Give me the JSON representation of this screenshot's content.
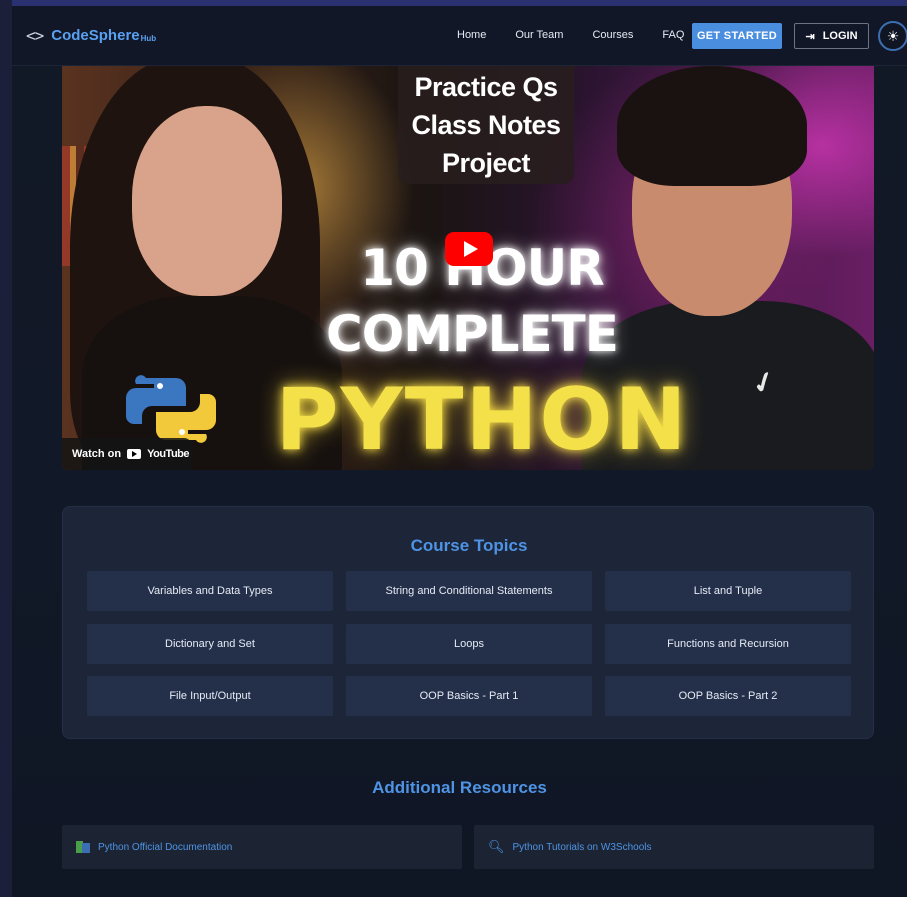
{
  "nav": {
    "brand_icon": "<>",
    "brand_name": "CodeSphere",
    "brand_suffix": "Hub",
    "links": [
      "Home",
      "Our Team",
      "Courses",
      "FAQ"
    ],
    "get_started": "GET STARTED",
    "login": "LOGIN",
    "theme_icon": "sun-icon"
  },
  "video": {
    "notes": [
      "Practice Qs",
      "Class Notes",
      "Project"
    ],
    "title_line1": "10 HOUR",
    "title_line2": "COMPLETE",
    "title_line3": "PYTHON",
    "watch_on": "Watch on",
    "youtube": "YouTube",
    "colors": {
      "play": "#ff0000",
      "python_glow": "#f4e14a"
    }
  },
  "topics": {
    "title": "Course Topics",
    "items": [
      "Variables and Data Types",
      "String and Conditional Statements",
      "List and Tuple",
      "Dictionary and Set",
      "Loops",
      "Functions and Recursion",
      "File Input/Output",
      "OOP Basics - Part 1",
      "OOP Basics - Part 2"
    ]
  },
  "resources": {
    "title": "Additional Resources",
    "items": [
      {
        "label": "Python Official Documentation",
        "icon": "docs-icon"
      },
      {
        "label": "Python Tutorials on W3Schools",
        "icon": "magnifier-icon"
      }
    ]
  },
  "colors": {
    "accent": "#4f93e4",
    "button": "#4a8ee0",
    "panel": "#1c2638"
  }
}
